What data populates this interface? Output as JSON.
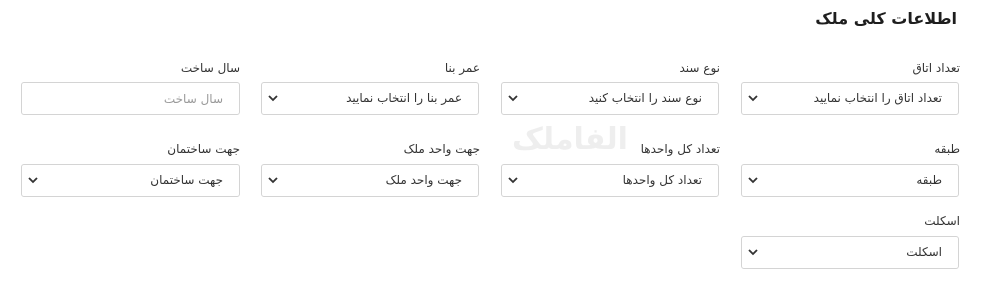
{
  "section": {
    "title": "اطلاعات کلی ملک"
  },
  "watermark": "الفاملک",
  "fields": {
    "rooms": {
      "label": "تعداد اتاق",
      "value": "تعداد اتاق را انتخاب نمایید"
    },
    "deed_type": {
      "label": "نوع سند",
      "value": "نوع سند را انتخاب کنید"
    },
    "building_age": {
      "label": "عمر بنا",
      "value": "عمر بنا را انتخاب نمایید"
    },
    "year_built": {
      "label": "سال ساخت",
      "placeholder": "سال ساخت",
      "value": ""
    },
    "floor": {
      "label": "طبقه",
      "value": "طبقه"
    },
    "total_units": {
      "label": "تعداد کل واحدها",
      "value": "تعداد کل واحدها"
    },
    "unit_direction": {
      "label": "جهت واحد ملک",
      "value": "جهت واحد ملک"
    },
    "building_direction": {
      "label": "جهت ساختمان",
      "value": "جهت ساختمان"
    },
    "skeleton": {
      "label": "اسکلت",
      "value": "اسکلت"
    }
  },
  "icons": {
    "dropdown": "chevron-down-icon"
  },
  "colors": {
    "border": "#d4d4d4",
    "text": "#333333",
    "placeholder": "#9a9a9a"
  }
}
